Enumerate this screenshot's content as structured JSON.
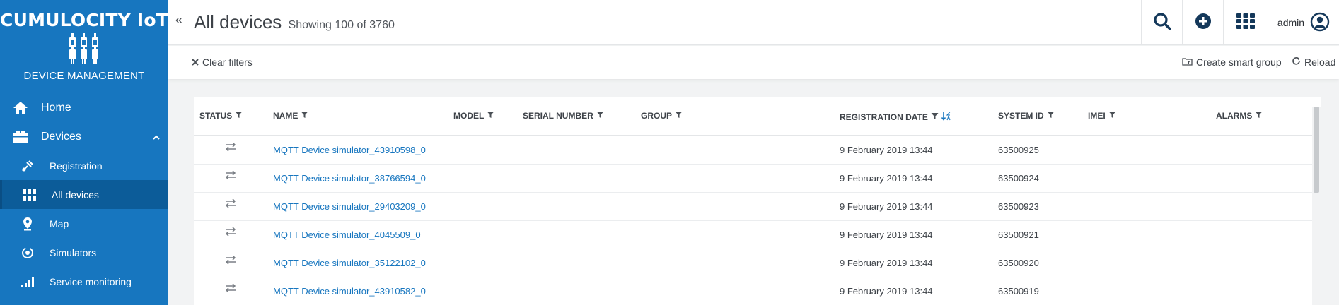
{
  "brand": {
    "title": "CUMULOCITY IoT",
    "subtitle": "DEVICE MANAGEMENT"
  },
  "nav": {
    "home": "Home",
    "devices": "Devices",
    "registration": "Registration",
    "all_devices": "All devices",
    "map": "Map",
    "simulators": "Simulators",
    "service_monitoring": "Service monitoring"
  },
  "header": {
    "collapse": "«",
    "title": "All devices",
    "count": "Showing 100 of 3760",
    "user": "admin"
  },
  "toolbar": {
    "clear_filters": "Clear filters",
    "create_smart_group": "Create smart group",
    "reload": "Reload"
  },
  "table": {
    "columns": {
      "status": "STATUS",
      "name": "NAME",
      "model": "MODEL",
      "serial": "SERIAL NUMBER",
      "group": "GROUP",
      "registration_date": "REGISTRATION DATE",
      "system_id": "SYSTEM ID",
      "imei": "IMEI",
      "alarms": "ALARMS"
    },
    "rows": [
      {
        "name": "MQTT Device simulator_43910598_0",
        "date": "9 February 2019 13:44",
        "system_id": "63500925"
      },
      {
        "name": "MQTT Device simulator_38766594_0",
        "date": "9 February 2019 13:44",
        "system_id": "63500924"
      },
      {
        "name": "MQTT Device simulator_29403209_0",
        "date": "9 February 2019 13:44",
        "system_id": "63500923"
      },
      {
        "name": "MQTT Device simulator_4045509_0",
        "date": "9 February 2019 13:44",
        "system_id": "63500921"
      },
      {
        "name": "MQTT Device simulator_35122102_0",
        "date": "9 February 2019 13:44",
        "system_id": "63500920"
      },
      {
        "name": "MQTT Device simulator_43910582_0",
        "date": "9 February 2019 13:44",
        "system_id": "63500919"
      }
    ]
  },
  "colors": {
    "sidebar": "#1776bf",
    "sidebar_active": "#0c5c99",
    "link": "#1776bf",
    "header_icons": "#14385a"
  },
  "icons": {
    "home": "home-icon",
    "devices": "devices-icon",
    "registration": "registration-icon",
    "all_devices": "all-devices-icon",
    "map": "map-pin-icon",
    "simulators": "simulators-icon",
    "service_monitoring": "signal-bars-icon",
    "search": "search-icon",
    "add": "plus-circle-icon",
    "apps": "app-grid-icon",
    "user": "user-circle-icon",
    "filter": "filter-icon",
    "sort": "sort-icon",
    "status": "connection-arrows-icon"
  }
}
